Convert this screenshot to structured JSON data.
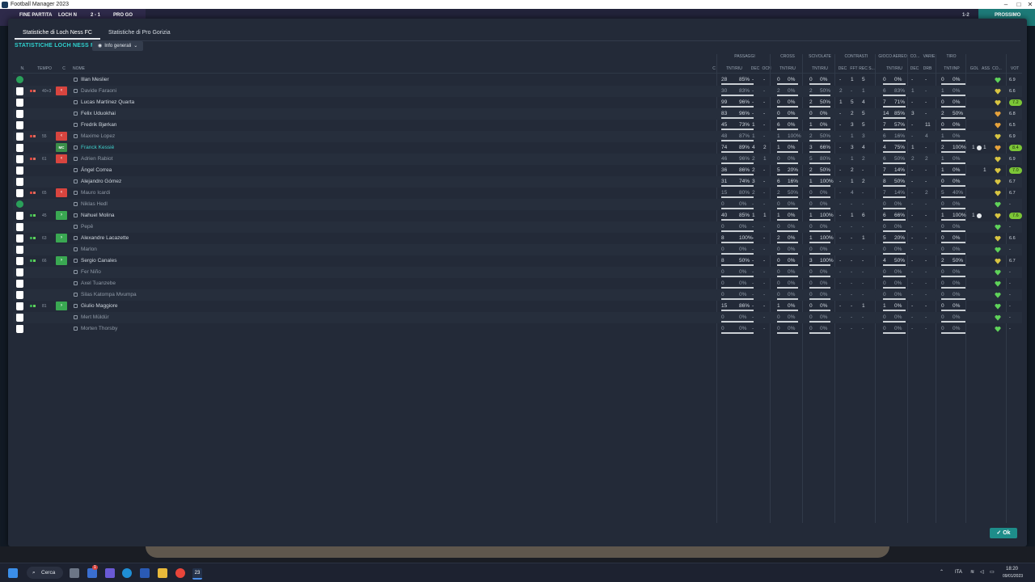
{
  "window": {
    "title": "Football Manager 2023"
  },
  "gamebar": {
    "left": "FINE PARTITA",
    "home": "LOCH N",
    "score": "2 - 1",
    "away": "PRO GO",
    "right": "PROSSIMO",
    "extra": "1-2"
  },
  "tabs": [
    "Statistiche di Loch Ness FC",
    "Statistiche di Pro Gorizia"
  ],
  "section_title": "STATISTICHE LOCH NESS FC",
  "view_select": "Info generali",
  "groups": [
    "PASSAGGI",
    "CROSS",
    "SCIVOLATE",
    "CONTRASTI",
    "GIOCO AEREO",
    "CO...",
    "VARIE",
    "TIRO"
  ],
  "headers": [
    "N.",
    "TEMPO",
    "C",
    "NOME",
    "C",
    "TNT/RIU",
    "DEC",
    "OCN",
    "TNT/RIU",
    "TNT/RIU",
    "DEC",
    "FFT",
    "REC S...",
    "TNT/RIU",
    "DEC",
    "DRB",
    "TNT/INP",
    "GOL",
    "ASS",
    "CO...",
    "VOT"
  ],
  "players": [
    {
      "name": "Illan Meslier",
      "gk": true,
      "pass_t": "28",
      "pass_p": "85%",
      "dec": "-",
      "ocn": "-",
      "cr_t": "0",
      "cr_p": "0%",
      "sc_t": "0",
      "sc_p": "0%",
      "ct_dec": "-",
      "fft": "1",
      "rec": "5",
      "ga_t": "0",
      "ga_p": "0%",
      "co": "-",
      "drb": "-",
      "sh_t": "0",
      "sh_p": "0%",
      "gol": "",
      "ass": "",
      "vot": "6.9",
      "heart": "#5fd35a"
    },
    {
      "name": "Davide Faraoni",
      "muted": true,
      "sub": "out",
      "time": "40+3",
      "pass_t": "30",
      "pass_p": "83%",
      "dec": "-",
      "ocn": "-",
      "cr_t": "2",
      "cr_p": "0%",
      "sc_t": "2",
      "sc_p": "50%",
      "ct_dec": "2",
      "fft": "-",
      "rec": "1",
      "ga_t": "6",
      "ga_p": "83%",
      "co": "1",
      "drb": "-",
      "sh_t": "1",
      "sh_p": "0%",
      "gol": "",
      "ass": "",
      "vot": "6.6",
      "heart": "#d8c542"
    },
    {
      "name": "Lucas Martínez Quarta",
      "pass_t": "99",
      "pass_p": "96%",
      "dec": "-",
      "ocn": "-",
      "cr_t": "0",
      "cr_p": "0%",
      "sc_t": "2",
      "sc_p": "50%",
      "ct_dec": "1",
      "fft": "5",
      "rec": "4",
      "ga_t": "7",
      "ga_p": "71%",
      "co": "-",
      "drb": "-",
      "sh_t": "0",
      "sh_p": "0%",
      "gol": "",
      "ass": "",
      "vot": "7.2",
      "heart": "#d8c542",
      "badge": true
    },
    {
      "name": "Felix Uduokhai",
      "pass_t": "83",
      "pass_p": "96%",
      "dec": "-",
      "ocn": "-",
      "cr_t": "0",
      "cr_p": "0%",
      "sc_t": "0",
      "sc_p": "0%",
      "ct_dec": "-",
      "fft": "2",
      "rec": "5",
      "ga_t": "14",
      "ga_p": "85%",
      "co": "3",
      "drb": "-",
      "sh_t": "2",
      "sh_p": "50%",
      "gol": "",
      "ass": "",
      "vot": "6.8",
      "heart": "#e6a23c"
    },
    {
      "name": "Fredrik Bjørkan",
      "pass_t": "45",
      "pass_p": "73%",
      "dec": "1",
      "ocn": "-",
      "cr_t": "6",
      "cr_p": "0%",
      "sc_t": "1",
      "sc_p": "0%",
      "ct_dec": "-",
      "fft": "3",
      "rec": "5",
      "ga_t": "7",
      "ga_p": "57%",
      "co": "-",
      "drb": "11",
      "sh_t": "0",
      "sh_p": "0%",
      "gol": "",
      "ass": "",
      "vot": "6.5",
      "heart": "#e6a23c"
    },
    {
      "name": "Maxime Lopez",
      "muted": true,
      "sub": "out",
      "time": "55",
      "pass_t": "48",
      "pass_p": "87%",
      "dec": "1",
      "ocn": "-",
      "cr_t": "1",
      "cr_p": "100%",
      "sc_t": "2",
      "sc_p": "50%",
      "ct_dec": "-",
      "fft": "1",
      "rec": "3",
      "ga_t": "6",
      "ga_p": "16%",
      "co": "-",
      "drb": "4",
      "sh_t": "1",
      "sh_p": "0%",
      "gol": "",
      "ass": "",
      "vot": "6.9",
      "heart": "#d8c542"
    },
    {
      "name": "Franck Kessié",
      "highlight": true,
      "mc": true,
      "pass_t": "74",
      "pass_p": "89%",
      "dec": "4",
      "ocn": "2",
      "cr_t": "1",
      "cr_p": "0%",
      "sc_t": "3",
      "sc_p": "66%",
      "ct_dec": "-",
      "fft": "3",
      "rec": "4",
      "ga_t": "4",
      "ga_p": "75%",
      "co": "1",
      "drb": "-",
      "sh_t": "2",
      "sh_p": "100%",
      "gol": "1",
      "ass": "1",
      "vot": "8.4",
      "heart": "#e6a23c",
      "badge": true
    },
    {
      "name": "Adrien Rabiot",
      "muted": true,
      "sub": "out",
      "time": "61",
      "pass_t": "46",
      "pass_p": "96%",
      "dec": "2",
      "ocn": "1",
      "cr_t": "0",
      "cr_p": "0%",
      "sc_t": "5",
      "sc_p": "80%",
      "ct_dec": "-",
      "fft": "1",
      "rec": "2",
      "ga_t": "6",
      "ga_p": "50%",
      "co": "2",
      "drb": "2",
      "sh_t": "1",
      "sh_p": "0%",
      "gol": "",
      "ass": "",
      "vot": "6.9",
      "heart": "#d8c542"
    },
    {
      "name": "Ángel Correa",
      "pass_t": "36",
      "pass_p": "86%",
      "dec": "2",
      "ocn": "-",
      "cr_t": "5",
      "cr_p": "20%",
      "sc_t": "2",
      "sc_p": "50%",
      "ct_dec": "-",
      "fft": "2",
      "rec": "-",
      "ga_t": "7",
      "ga_p": "14%",
      "co": "-",
      "drb": "-",
      "sh_t": "1",
      "sh_p": "0%",
      "gol": "",
      "ass": "1",
      "vot": "7.0",
      "heart": "#d8c542",
      "badge": true
    },
    {
      "name": "Alejandro Gómez",
      "pass_t": "31",
      "pass_p": "74%",
      "dec": "3",
      "ocn": "-",
      "cr_t": "6",
      "cr_p": "16%",
      "sc_t": "1",
      "sc_p": "100%",
      "ct_dec": "-",
      "fft": "1",
      "rec": "2",
      "ga_t": "8",
      "ga_p": "50%",
      "co": "-",
      "drb": "-",
      "sh_t": "0",
      "sh_p": "0%",
      "gol": "",
      "ass": "",
      "vot": "6.7",
      "heart": "#d8c542"
    },
    {
      "name": "Mauro Icardi",
      "muted": true,
      "sub": "out",
      "time": "65",
      "pass_t": "15",
      "pass_p": "80%",
      "dec": "2",
      "ocn": "-",
      "cr_t": "2",
      "cr_p": "50%",
      "sc_t": "0",
      "sc_p": "0%",
      "ct_dec": "-",
      "fft": "4",
      "rec": "-",
      "ga_t": "7",
      "ga_p": "14%",
      "co": "-",
      "drb": "2",
      "sh_t": "5",
      "sh_p": "40%",
      "gol": "",
      "ass": "",
      "vot": "6.7",
      "heart": "#d8c542"
    },
    {
      "name": "Niklas Hedl",
      "muted": true,
      "gk": true,
      "pass_t": "0",
      "pass_p": "0%",
      "dec": "-",
      "ocn": "-",
      "cr_t": "0",
      "cr_p": "0%",
      "sc_t": "0",
      "sc_p": "0%",
      "ct_dec": "-",
      "fft": "-",
      "rec": "-",
      "ga_t": "0",
      "ga_p": "0%",
      "co": "-",
      "drb": "-",
      "sh_t": "0",
      "sh_p": "0%",
      "gol": "",
      "ass": "",
      "vot": "-",
      "heart": "#5fd35a"
    },
    {
      "name": "Nahuel Molina",
      "sub": "in",
      "time": "45",
      "pass_t": "40",
      "pass_p": "85%",
      "dec": "1",
      "ocn": "1",
      "cr_t": "1",
      "cr_p": "0%",
      "sc_t": "1",
      "sc_p": "100%",
      "ct_dec": "-",
      "fft": "1",
      "rec": "6",
      "ga_t": "6",
      "ga_p": "66%",
      "co": "-",
      "drb": "-",
      "sh_t": "1",
      "sh_p": "100%",
      "gol": "1",
      "ass": "",
      "vot": "7.6",
      "heart": "#d8c542",
      "badge": true
    },
    {
      "name": "Pepê",
      "muted": true,
      "pass_t": "0",
      "pass_p": "0%",
      "dec": "-",
      "ocn": "-",
      "cr_t": "0",
      "cr_p": "0%",
      "sc_t": "0",
      "sc_p": "0%",
      "ct_dec": "-",
      "fft": "-",
      "rec": "-",
      "ga_t": "0",
      "ga_p": "0%",
      "co": "-",
      "drb": "-",
      "sh_t": "0",
      "sh_p": "0%",
      "gol": "",
      "ass": "",
      "vot": "-",
      "heart": "#5fd35a"
    },
    {
      "name": "Alexandre Lacazette",
      "sub": "in",
      "time": "63",
      "pass_t": "8",
      "pass_p": "100%",
      "dec": "-",
      "ocn": "-",
      "cr_t": "2",
      "cr_p": "0%",
      "sc_t": "1",
      "sc_p": "100%",
      "ct_dec": "-",
      "fft": "-",
      "rec": "1",
      "ga_t": "5",
      "ga_p": "20%",
      "co": "-",
      "drb": "-",
      "sh_t": "0",
      "sh_p": "0%",
      "gol": "",
      "ass": "",
      "vot": "6.6",
      "heart": "#d8c542"
    },
    {
      "name": "Marlon",
      "muted": true,
      "pass_t": "0",
      "pass_p": "0%",
      "dec": "-",
      "ocn": "-",
      "cr_t": "0",
      "cr_p": "0%",
      "sc_t": "0",
      "sc_p": "0%",
      "ct_dec": "-",
      "fft": "-",
      "rec": "-",
      "ga_t": "0",
      "ga_p": "0%",
      "co": "-",
      "drb": "-",
      "sh_t": "0",
      "sh_p": "0%",
      "gol": "",
      "ass": "",
      "vot": "-",
      "heart": "#5fd35a"
    },
    {
      "name": "Sergio Canales",
      "sub": "in",
      "time": "66",
      "pass_t": "8",
      "pass_p": "50%",
      "dec": "-",
      "ocn": "-",
      "cr_t": "0",
      "cr_p": "0%",
      "sc_t": "3",
      "sc_p": "100%",
      "ct_dec": "-",
      "fft": "-",
      "rec": "-",
      "ga_t": "4",
      "ga_p": "50%",
      "co": "-",
      "drb": "-",
      "sh_t": "2",
      "sh_p": "50%",
      "gol": "",
      "ass": "",
      "vot": "6.7",
      "heart": "#d8c542"
    },
    {
      "name": "Fer Niño",
      "muted": true,
      "pass_t": "0",
      "pass_p": "0%",
      "dec": "-",
      "ocn": "-",
      "cr_t": "0",
      "cr_p": "0%",
      "sc_t": "0",
      "sc_p": "0%",
      "ct_dec": "-",
      "fft": "-",
      "rec": "-",
      "ga_t": "0",
      "ga_p": "0%",
      "co": "-",
      "drb": "-",
      "sh_t": "0",
      "sh_p": "0%",
      "gol": "",
      "ass": "",
      "vot": "-",
      "heart": "#5fd35a"
    },
    {
      "name": "Axel Tuanzebe",
      "muted": true,
      "pass_t": "0",
      "pass_p": "0%",
      "dec": "-",
      "ocn": "-",
      "cr_t": "0",
      "cr_p": "0%",
      "sc_t": "0",
      "sc_p": "0%",
      "ct_dec": "-",
      "fft": "-",
      "rec": "-",
      "ga_t": "0",
      "ga_p": "0%",
      "co": "-",
      "drb": "-",
      "sh_t": "0",
      "sh_p": "0%",
      "gol": "",
      "ass": "",
      "vot": "-",
      "heart": "#5fd35a"
    },
    {
      "name": "Silas Katompa Mvumpa",
      "muted": true,
      "pass_t": "0",
      "pass_p": "0%",
      "dec": "-",
      "ocn": "-",
      "cr_t": "0",
      "cr_p": "0%",
      "sc_t": "0",
      "sc_p": "0%",
      "ct_dec": "-",
      "fft": "-",
      "rec": "-",
      "ga_t": "0",
      "ga_p": "0%",
      "co": "-",
      "drb": "-",
      "sh_t": "0",
      "sh_p": "0%",
      "gol": "",
      "ass": "",
      "vot": "-",
      "heart": "#5fd35a"
    },
    {
      "name": "Giulio Maggiore",
      "sub": "in",
      "time": "81",
      "pass_t": "15",
      "pass_p": "86%",
      "dec": "-",
      "ocn": "-",
      "cr_t": "1",
      "cr_p": "0%",
      "sc_t": "0",
      "sc_p": "0%",
      "ct_dec": "-",
      "fft": "-",
      "rec": "1",
      "ga_t": "1",
      "ga_p": "0%",
      "co": "-",
      "drb": "-",
      "sh_t": "0",
      "sh_p": "0%",
      "gol": "",
      "ass": "",
      "vot": "-",
      "heart": "#5fd35a"
    },
    {
      "name": "Mert Müldür",
      "muted": true,
      "pass_t": "0",
      "pass_p": "0%",
      "dec": "-",
      "ocn": "-",
      "cr_t": "0",
      "cr_p": "0%",
      "sc_t": "0",
      "sc_p": "0%",
      "ct_dec": "-",
      "fft": "-",
      "rec": "-",
      "ga_t": "0",
      "ga_p": "0%",
      "co": "-",
      "drb": "-",
      "sh_t": "0",
      "sh_p": "0%",
      "gol": "",
      "ass": "",
      "vot": "-",
      "heart": "#5fd35a"
    },
    {
      "name": "Morten Thorsby",
      "muted": true,
      "pass_t": "0",
      "pass_p": "0%",
      "dec": "-",
      "ocn": "-",
      "cr_t": "0",
      "cr_p": "0%",
      "sc_t": "0",
      "sc_p": "0%",
      "ct_dec": "-",
      "fft": "-",
      "rec": "-",
      "ga_t": "0",
      "ga_p": "0%",
      "co": "-",
      "drb": "-",
      "sh_t": "0",
      "sh_p": "0%",
      "gol": "",
      "ass": "",
      "vot": "-",
      "heart": "#5fd35a"
    }
  ],
  "ok_label": "Ok",
  "taskbar": {
    "search": "Cerca",
    "lang": "ITA",
    "time": "18:20",
    "date": "09/01/2023",
    "notif_count": "1"
  },
  "colors": {
    "accent": "#2fd3d0",
    "ok": "#1e8d8a",
    "sub_out": "#d8453f",
    "sub_in": "#3aa852"
  }
}
